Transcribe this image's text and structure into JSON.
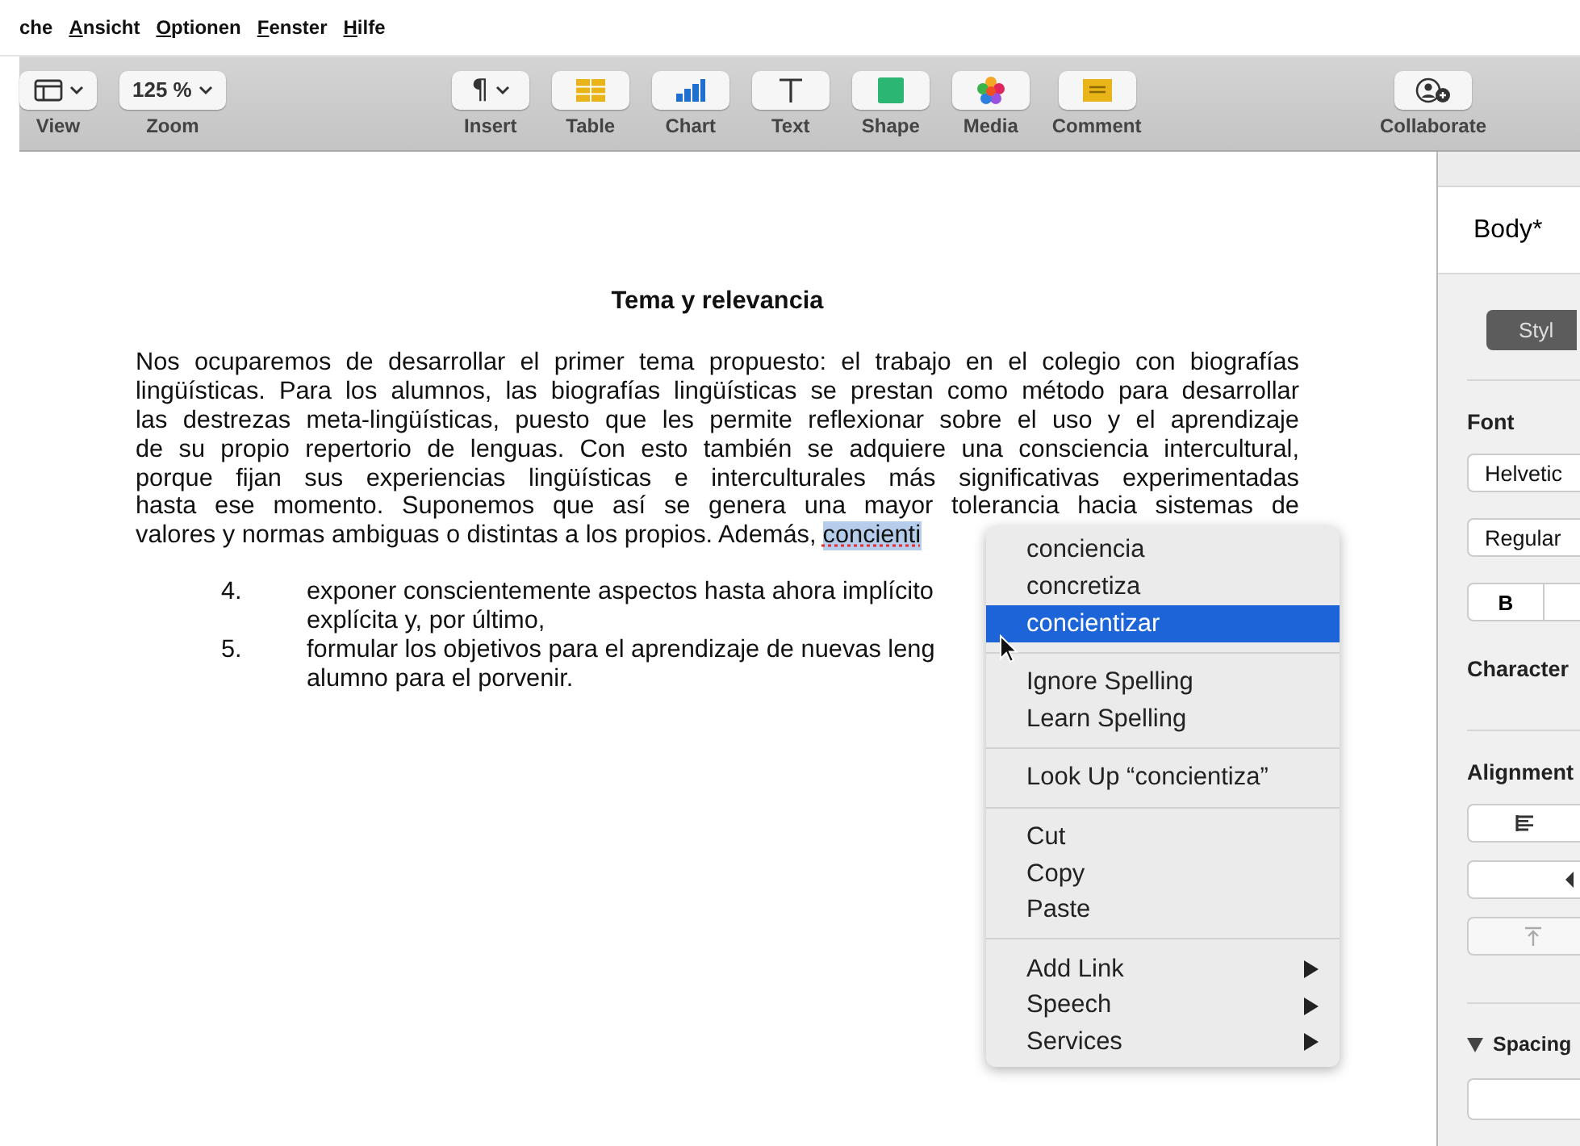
{
  "menu_bar": [
    {
      "label": "che",
      "mnemonic": false
    },
    {
      "label": "Ansicht",
      "mnemonic": true
    },
    {
      "label": "Optionen",
      "mnemonic": true
    },
    {
      "label": "Fenster",
      "mnemonic": true
    },
    {
      "label": "Hilfe",
      "mnemonic": true
    }
  ],
  "toolbar": {
    "left": [
      {
        "kind": "view",
        "label": "View",
        "caret": true
      },
      {
        "kind": "zoom",
        "label": "Zoom",
        "value": "125 %",
        "caret": true
      }
    ],
    "center": [
      {
        "kind": "insert",
        "label": "Insert",
        "glyph": "¶",
        "caret": true
      },
      {
        "kind": "table",
        "label": "Table",
        "caret": false
      },
      {
        "kind": "chart",
        "label": "Chart",
        "caret": false
      },
      {
        "kind": "text",
        "label": "Text",
        "caret": false
      },
      {
        "kind": "shape",
        "label": "Shape",
        "caret": false
      },
      {
        "kind": "media",
        "label": "Media",
        "caret": false
      },
      {
        "kind": "comment",
        "label": "Comment",
        "caret": false
      }
    ],
    "right": [
      {
        "kind": "collaborate",
        "label": "Collaborate",
        "caret": false
      }
    ]
  },
  "document": {
    "title": "Tema y relevancia",
    "paragraph_lines": [
      "Nos ocuparemos de desarrollar el primer tema propuesto: el trabajo en el colegio con biografías",
      "lingüísticas. Para los alumnos, las biografías lingüísticas se prestan como método para desarrollar",
      "las destrezas meta-lingüísticas, puesto que les permite reflexionar sobre el uso y el aprendizaje",
      "de su propio repertorio de lenguas. Con esto también se adquiere una consciencia intercultural,",
      "porque fijan sus experiencias lingüísticas e interculturales más significativas experimentadas",
      "hasta ese momento. Suponemos que así se genera una mayor tolerancia hacia sistemas de"
    ],
    "last_line": "valores y normas ambiguas o distintas a los propios. Además,",
    "misspelled": "concienti",
    "list": [
      {
        "number": "4.",
        "lines": [
          "exponer conscientemente aspectos hasta ahora implícito",
          "explícita y, por último,"
        ]
      },
      {
        "number": "5.",
        "lines": [
          "formular los objetivos para el aprendizaje de nuevas leng",
          "alumno para el porvenir."
        ]
      }
    ]
  },
  "context_menu": {
    "groups": [
      [
        {
          "label": "conciencia",
          "selected": false,
          "submenu": false
        },
        {
          "label": "concretiza",
          "selected": false,
          "submenu": false
        },
        {
          "label": "concientizar",
          "selected": true,
          "submenu": false
        }
      ],
      [
        {
          "label": "Ignore Spelling",
          "selected": false,
          "submenu": false
        },
        {
          "label": "Learn Spelling",
          "selected": false,
          "submenu": false
        }
      ],
      [
        {
          "label": "Look Up “concientiza”",
          "selected": false,
          "submenu": false
        }
      ],
      [
        {
          "label": "Cut",
          "selected": false,
          "submenu": false
        },
        {
          "label": "Copy",
          "selected": false,
          "submenu": false
        },
        {
          "label": "Paste",
          "selected": false,
          "submenu": false
        }
      ],
      [
        {
          "label": "Add Link",
          "selected": false,
          "submenu": true
        },
        {
          "label": "Speech",
          "selected": false,
          "submenu": true
        },
        {
          "label": "Services",
          "selected": false,
          "submenu": true
        }
      ]
    ]
  },
  "sidebar": {
    "style_name": "Body*",
    "tabs": [
      {
        "label": "Styl",
        "selected": true
      }
    ],
    "font_heading": "Font",
    "font_family": "Helvetic",
    "font_weight": "Regular",
    "bold_button": "B",
    "character_heading": "Character",
    "alignment_heading": "Alignment",
    "spacing_heading": "Spacing",
    "spacing_expanded": true
  }
}
